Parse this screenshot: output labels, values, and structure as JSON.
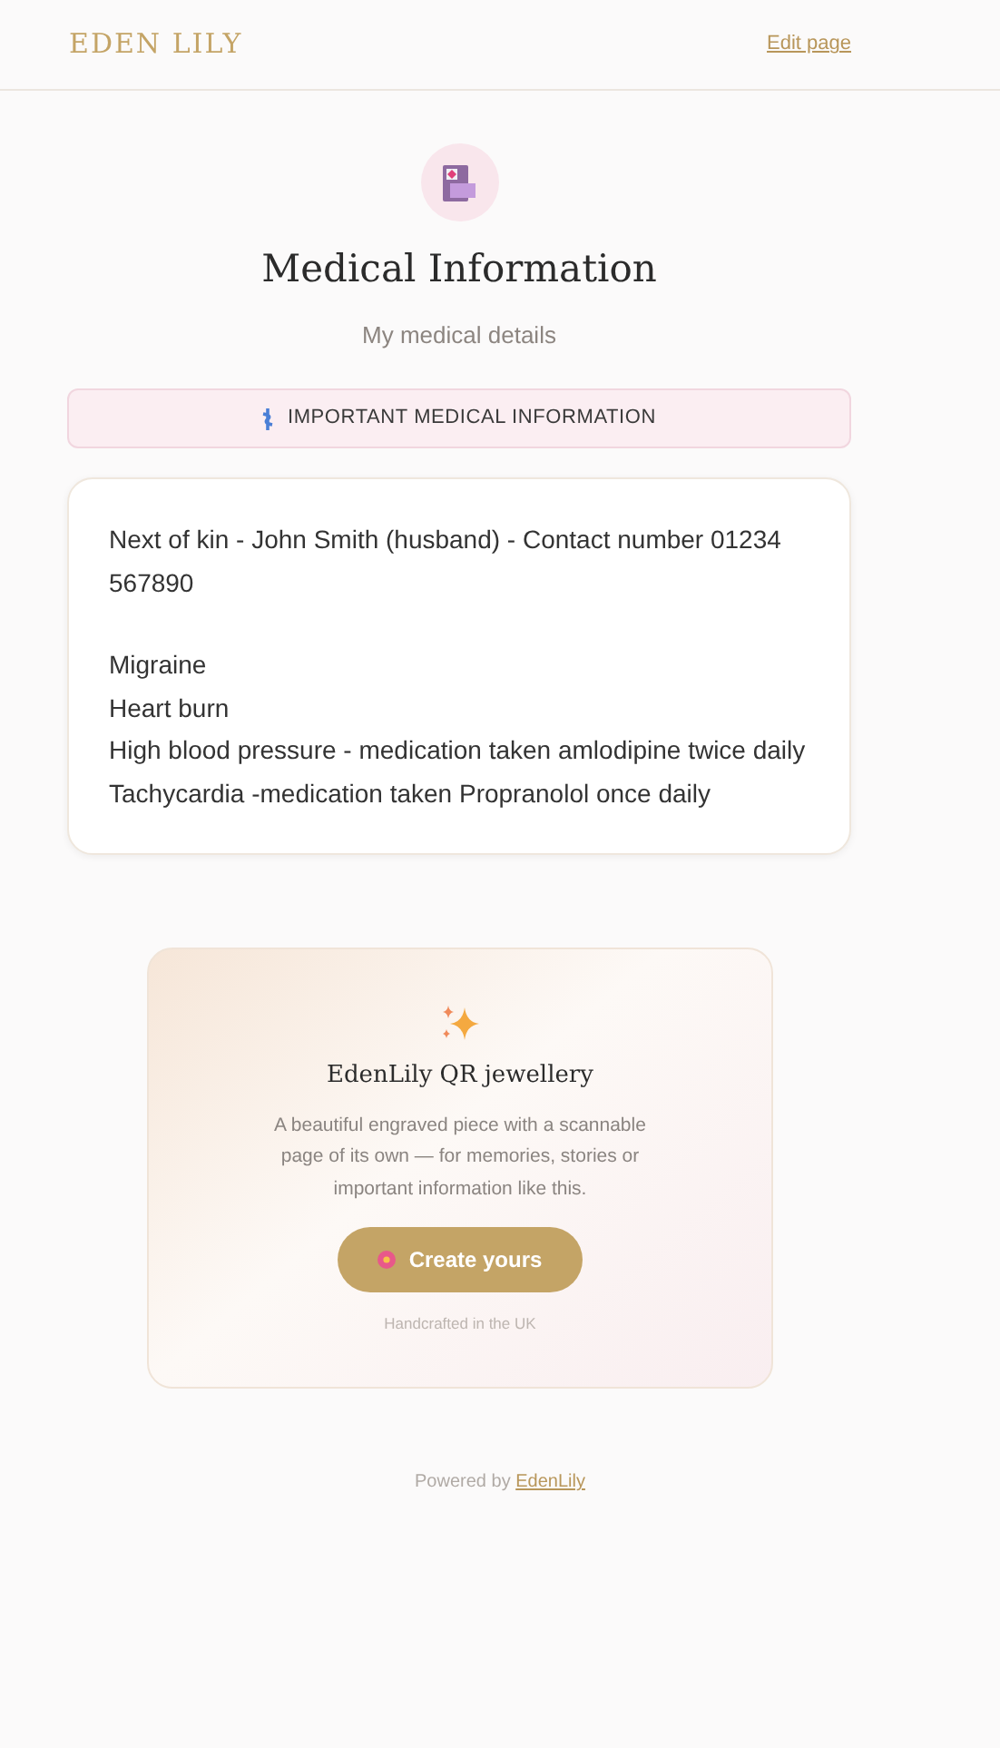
{
  "header": {
    "logo": "EDEN LILY",
    "edit_link": "Edit page"
  },
  "page": {
    "title": "Medical Information",
    "subtitle": "My medical details"
  },
  "banner": {
    "label": "IMPORTANT MEDICAL INFORMATION"
  },
  "details": {
    "paragraphs": [
      [
        "Next of kin - John Smith (husband) - Contact number 01234 567890"
      ],
      [
        "Migraine",
        "Heart burn",
        "High blood pressure - medication taken amlodipine twice daily",
        "Tachycardia -medication taken Propranolol once daily"
      ]
    ]
  },
  "promo": {
    "title": "EdenLily QR jewellery",
    "description": "A beautiful engraved piece with a scannable page of its own — for memories, stories or important information like this.",
    "button": "Create yours",
    "note": "Handcrafted in the UK"
  },
  "footer": {
    "prefix": "Powered by",
    "link": "EdenLily"
  }
}
